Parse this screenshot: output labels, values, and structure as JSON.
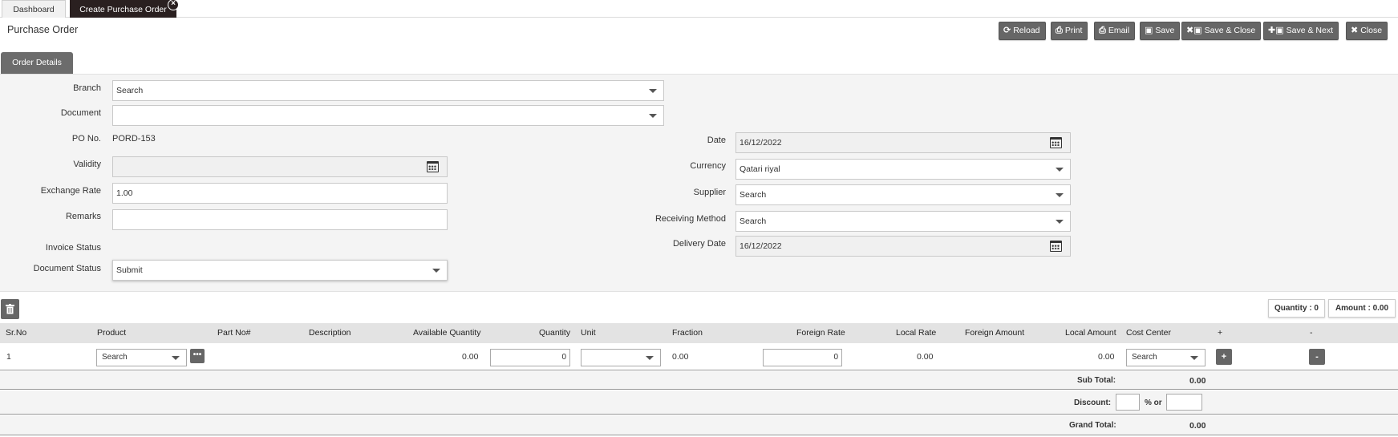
{
  "tabs": [
    {
      "label": "Dashboard"
    },
    {
      "label": "Create Purchase Order"
    }
  ],
  "page_title": "Purchase Order",
  "toolbar": {
    "reload": "Reload",
    "print": "Print",
    "email": "Email",
    "save": "Save",
    "save_close": "Save & Close",
    "save_next": "Save & Next",
    "close": "Close"
  },
  "section_tab": "Order Details",
  "form": {
    "branch": {
      "label": "Branch",
      "value": "Search"
    },
    "document": {
      "label": "Document",
      "value": ""
    },
    "po_no": {
      "label": "PO No.",
      "value": "PORD-153"
    },
    "validity": {
      "label": "Validity",
      "value": ""
    },
    "exchange_rate": {
      "label": "Exchange Rate",
      "value": "1.00"
    },
    "remarks": {
      "label": "Remarks",
      "value": ""
    },
    "invoice_status": {
      "label": "Invoice Status",
      "value": ""
    },
    "document_status": {
      "label": "Document Status",
      "value": "Submit"
    },
    "date": {
      "label": "Date",
      "value": "16/12/2022"
    },
    "currency": {
      "label": "Currency",
      "value": "Qatari riyal"
    },
    "supplier": {
      "label": "Supplier",
      "value": "Search"
    },
    "receiving_method": {
      "label": "Receiving Method",
      "value": "Search"
    },
    "delivery_date": {
      "label": "Delivery Date",
      "value": "16/12/2022"
    }
  },
  "summary": {
    "quantity": "Quantity : 0",
    "amount": "Amount : 0.00"
  },
  "grid": {
    "headers": [
      "Sr.No",
      "Product",
      "Part No#",
      "Description",
      "Available Quantity",
      "Quantity",
      "Unit",
      "Fraction",
      "Foreign Rate",
      "Local Rate",
      "Foreign Amount",
      "Local Amount",
      "Cost Center",
      "+",
      "-"
    ],
    "rows": [
      {
        "sr_no": "1",
        "product": "Search",
        "available_quantity": "0.00",
        "quantity": "0",
        "unit": "",
        "fraction": "0.00",
        "foreign_rate": "0",
        "local_rate": "0.00",
        "local_amount": "0.00",
        "cost_center": "Search",
        "add": "+",
        "remove": "-"
      }
    ]
  },
  "totals": {
    "sub_total_label": "Sub Total:",
    "sub_total": "0.00",
    "discount_label": "Discount:",
    "discount_or": "% or",
    "grand_total_label": "Grand Total:",
    "grand_total": "0.00"
  },
  "icons": {
    "close_tab": "close-circle-icon",
    "reload": "refresh-icon",
    "print": "printer-icon",
    "email": "printer-icon",
    "save": "floppy-icon",
    "save_close": "x-floppy-icon",
    "save_next": "plus-floppy-icon",
    "close": "x-icon",
    "calendar": "calendar-icon",
    "trash": "trash-icon",
    "more": "ellipsis-icon"
  }
}
